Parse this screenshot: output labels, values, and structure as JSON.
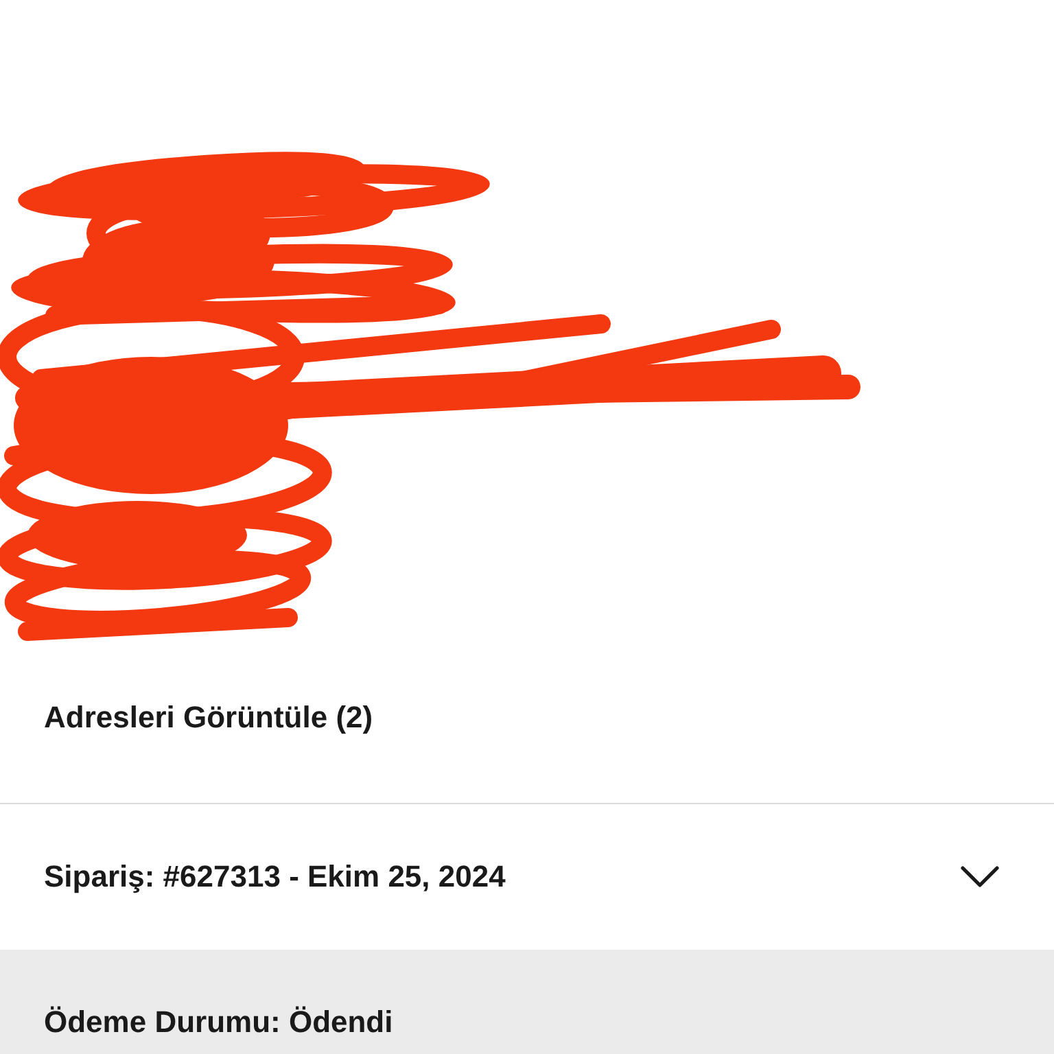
{
  "addresses": {
    "link": "Adresleri Görüntüle (2)"
  },
  "order": {
    "title": "Sipariş: #627313 - Ekim 25, 2024",
    "expanded": false
  },
  "payment": {
    "status": "Ödeme Durumu: Ödendi"
  }
}
